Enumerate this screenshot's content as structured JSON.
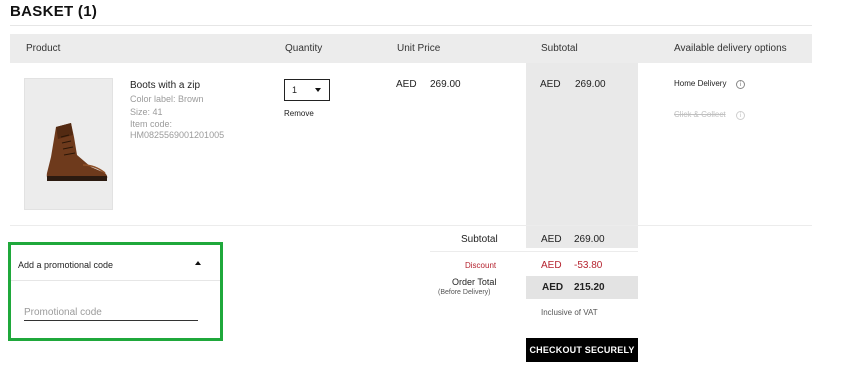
{
  "basket": {
    "title": "BASKET (1)"
  },
  "table_headers": {
    "product": "Product",
    "quantity": "Quantity",
    "unit_price": "Unit Price",
    "subtotal": "Subtotal",
    "delivery": "Available delivery options"
  },
  "item": {
    "name": "Boots with a zip",
    "color": "Color label: Brown",
    "size": "Size: 41",
    "item_code_label": "Item code:",
    "item_code": "HM0825569001201005",
    "quantity": "1",
    "remove_label": "Remove",
    "currency": "AED",
    "unit_price": "269.00",
    "subtotal": "269.00",
    "delivery_options": [
      "Home Delivery",
      "Click & Collect"
    ],
    "image_icon": "brown-boot"
  },
  "summary": {
    "subtotal_label": "Subtotal",
    "subtotal_currency": "AED",
    "subtotal_value": "269.00",
    "discount_label": "Discount",
    "discount_currency": "AED",
    "discount_value": "-53.80",
    "order_total_label": "Order Total",
    "order_total_sub": "(Before Delivery)",
    "order_total_currency": "AED",
    "order_total_value": "215.20",
    "vat_note": "Inclusive of VAT",
    "checkout_label": "CHECKOUT SECURELY"
  },
  "promo": {
    "header": "Add a promotional code",
    "placeholder": "Promotional code",
    "value": ""
  },
  "colors": {
    "highlight_border": "#1fa83b",
    "discount": "#b5232f",
    "checkout_bg": "#000000"
  }
}
